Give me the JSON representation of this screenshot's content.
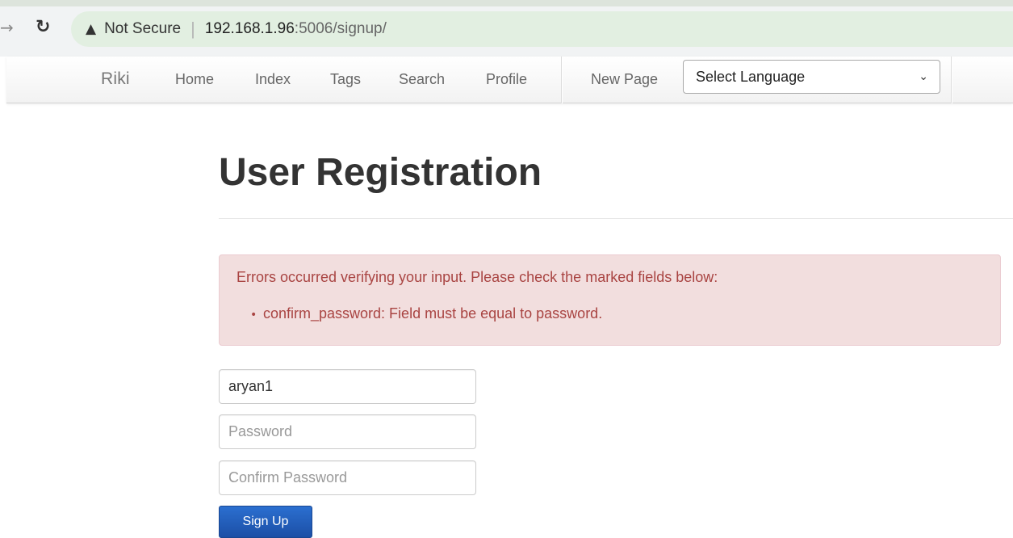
{
  "browser": {
    "not_secure_label": "Not Secure",
    "url_host": "192.168.1.96",
    "url_rest": ":5006/signup/",
    "icons": {
      "forward": "forward-arrow-icon",
      "reload": "reload-icon",
      "warning": "warning-icon"
    }
  },
  "navbar": {
    "brand": "Riki",
    "links": [
      "Home",
      "Index",
      "Tags",
      "Search",
      "Profile",
      "New Page"
    ],
    "language_select": {
      "value": "Select Language",
      "icon": "chevron-down-icon"
    }
  },
  "page": {
    "title": "User Registration",
    "alert": {
      "message": "Errors occurred verifying your input. Please check the marked fields below:",
      "items": [
        "confirm_password: Field must be equal to password."
      ],
      "color": "#a94442",
      "background": "#f2dede"
    },
    "form": {
      "username_value": "aryan1",
      "password_placeholder": "Password",
      "confirm_password_placeholder": "Confirm Password",
      "submit_label": "Sign Up"
    }
  }
}
